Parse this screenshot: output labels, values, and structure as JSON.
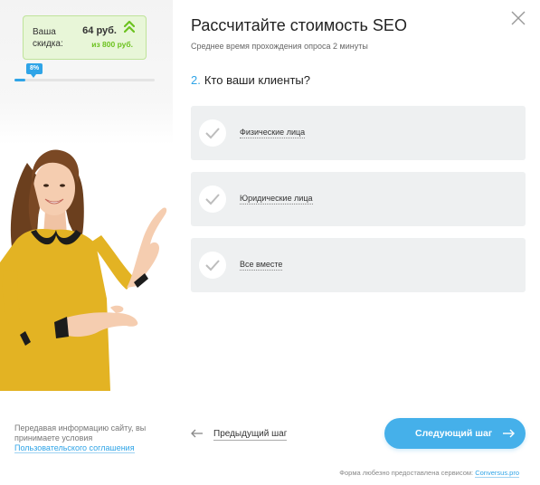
{
  "discount": {
    "label": "Ваша скидка:",
    "amount": "64 руб.",
    "from": "из 800 руб."
  },
  "progress": {
    "percent_label": "8%",
    "value": 0.08
  },
  "legal": {
    "text": "Передавая информацию сайту, вы принимаете условия",
    "link": "Пользовательского соглашения"
  },
  "header": {
    "title": "Рассчитайте стоимость SEO",
    "subtitle": "Среднее время прохождения опроса 2 минуты"
  },
  "question": {
    "number": "2.",
    "text": "Кто ваши клиенты?"
  },
  "options": [
    {
      "label": "Физические лица"
    },
    {
      "label": "Юридические лица"
    },
    {
      "label": "Все вместе"
    }
  ],
  "navigation": {
    "prev_label": "Предыдущий шаг",
    "next_label": "Следующий шаг"
  },
  "footer": {
    "note": "Форма любезно предоставлена сервисом:",
    "brand": "Conversus.pro"
  },
  "colors": {
    "accent": "#2fa4e7",
    "button": "#45b0ea",
    "discount_bg": "#e8f6d8",
    "discount_green": "#6cc21f",
    "option_bg": "#eef0f1",
    "dress": "#e3b323"
  }
}
